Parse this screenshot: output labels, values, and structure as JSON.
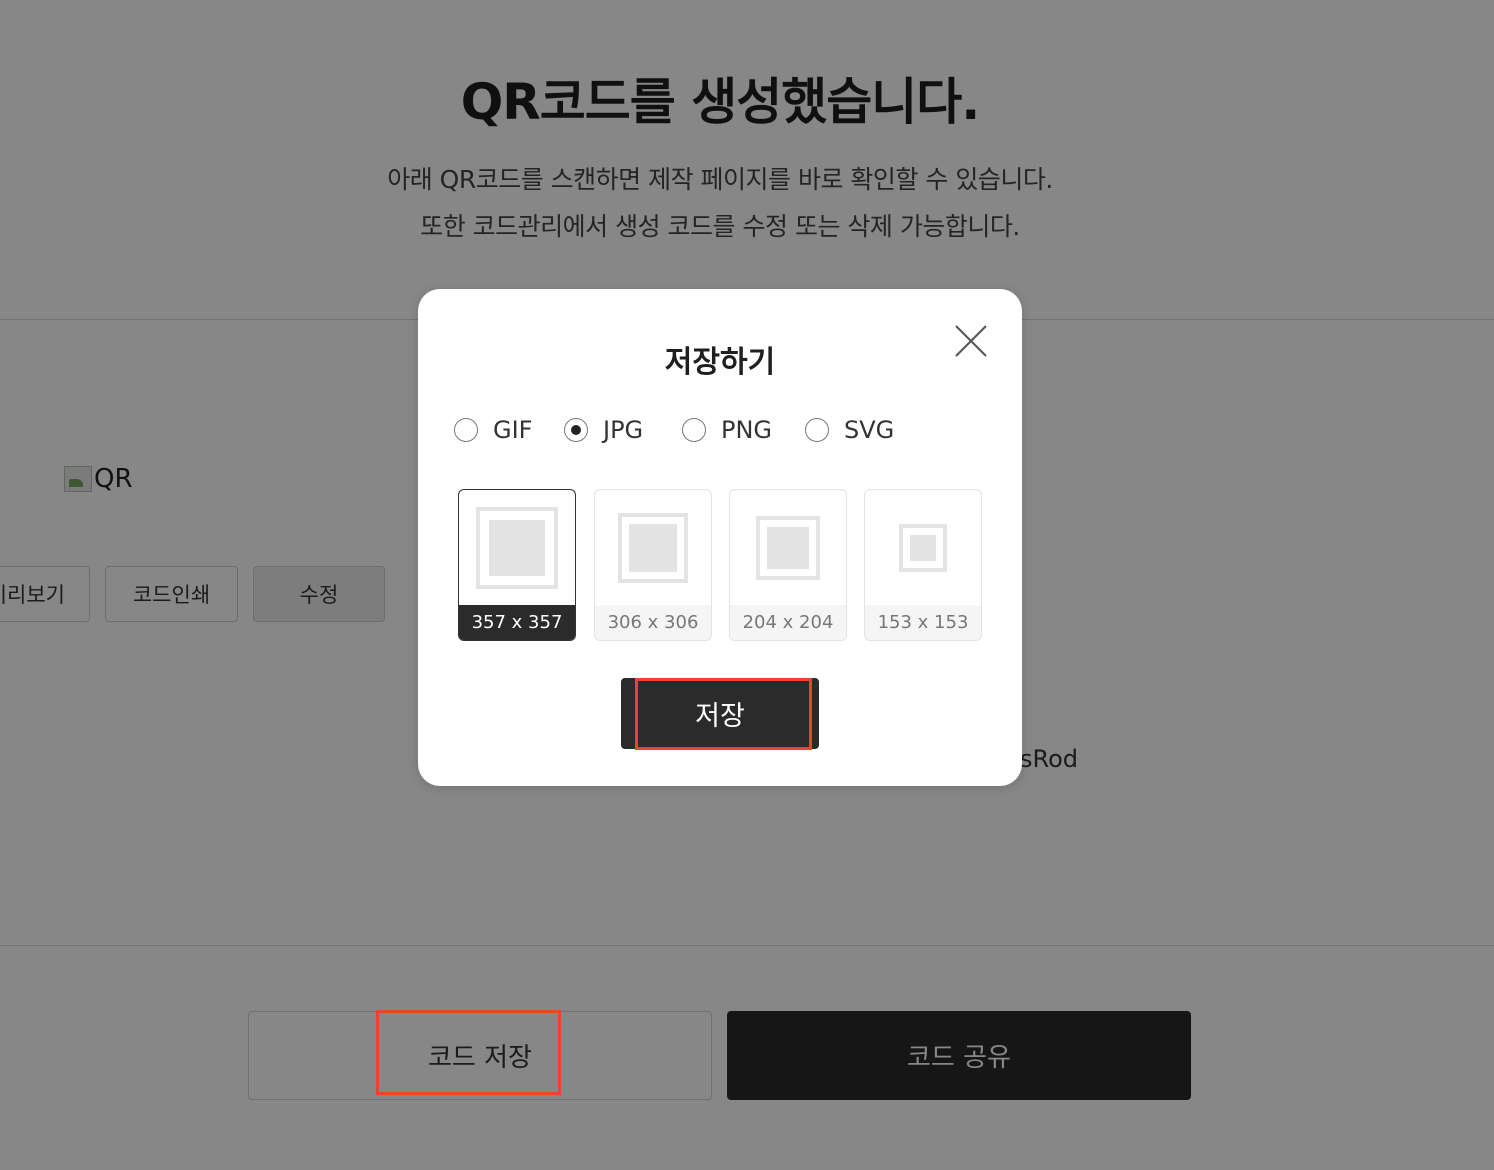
{
  "page": {
    "title": "QR코드를 생성했습니다.",
    "description_line1": "아래 QR코드를 스캔하면 제작 페이지를 바로 확인할 수 있습니다.",
    "description_line2": "또한 코드관리에서 생성 코드를 수정 또는 삭제 가능합니다.",
    "qr_alt_text": "QR",
    "side_buttons": {
      "preview": "미리보기",
      "print": "코드인쇄",
      "edit": "수정"
    },
    "url_fragment": "sRod",
    "bottom_buttons": {
      "save": "코드 저장",
      "share": "코드 공유"
    }
  },
  "modal": {
    "title": "저장하기",
    "formats": [
      {
        "label": "GIF",
        "checked": false
      },
      {
        "label": "JPG",
        "checked": true
      },
      {
        "label": "PNG",
        "checked": false
      },
      {
        "label": "SVG",
        "checked": false
      }
    ],
    "sizes": [
      {
        "label": "357 x 357",
        "selected": true
      },
      {
        "label": "306 x 306",
        "selected": false
      },
      {
        "label": "204 x 204",
        "selected": false
      },
      {
        "label": "153 x 153",
        "selected": false
      }
    ],
    "save_label": "저장"
  },
  "colors": {
    "highlight": "#e8452c",
    "dark_button": "#2b2b2b",
    "overlay": "rgba(0,0,0,0.47)"
  }
}
